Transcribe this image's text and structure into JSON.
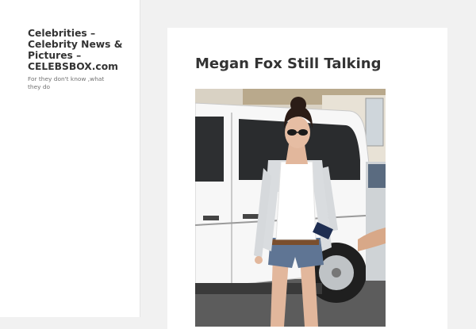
{
  "site": {
    "title": "Celebrities – Celebrity News & Pictures – CELEBSBOX.com",
    "description": "For they don't know ,what they do"
  },
  "post": {
    "title": "Megan Fox Still Talking"
  },
  "colors": {
    "page_bg": "#f1f1f1",
    "card_bg": "#ffffff",
    "title_text": "#333333",
    "muted_text": "#707070"
  }
}
